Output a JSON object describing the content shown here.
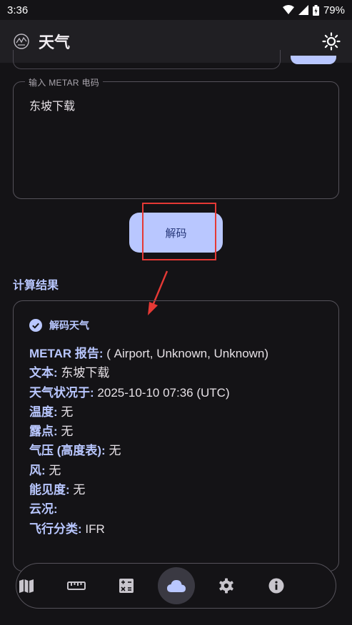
{
  "status": {
    "time": "3:36",
    "battery": "79%"
  },
  "app": {
    "title": "天气"
  },
  "metar": {
    "legend": "输入 METAR 电码",
    "value": "东坡下载"
  },
  "decode_button": "解码",
  "section_title": "计算结果",
  "result": {
    "header": "解码天气",
    "lines": [
      {
        "key": "METAR 报告:",
        "value": "( Airport, Unknown, Unknown)"
      },
      {
        "key": "文本:",
        "value": "东坡下载"
      },
      {
        "key": "天气状况于:",
        "value": "2025-10-10 07:36 (UTC)"
      },
      {
        "key": "温度:",
        "value": "无"
      },
      {
        "key": "露点:",
        "value": "无"
      },
      {
        "key": "气压 (高度表):",
        "value": "无"
      },
      {
        "key": "风:",
        "value": "无"
      },
      {
        "key": "能见度:",
        "value": "无"
      },
      {
        "key": "云况:",
        "value": ""
      },
      {
        "key": "飞行分类:",
        "value": "IFR"
      }
    ]
  },
  "colors": {
    "accent": "#b9c7ff",
    "background": "#141316",
    "highlight": "#e53935"
  },
  "nav": {
    "icons": [
      "map-icon",
      "ruler-icon",
      "calculator-icon",
      "cloud-icon",
      "settings-icon",
      "info-icon"
    ],
    "active": "cloud-icon"
  }
}
